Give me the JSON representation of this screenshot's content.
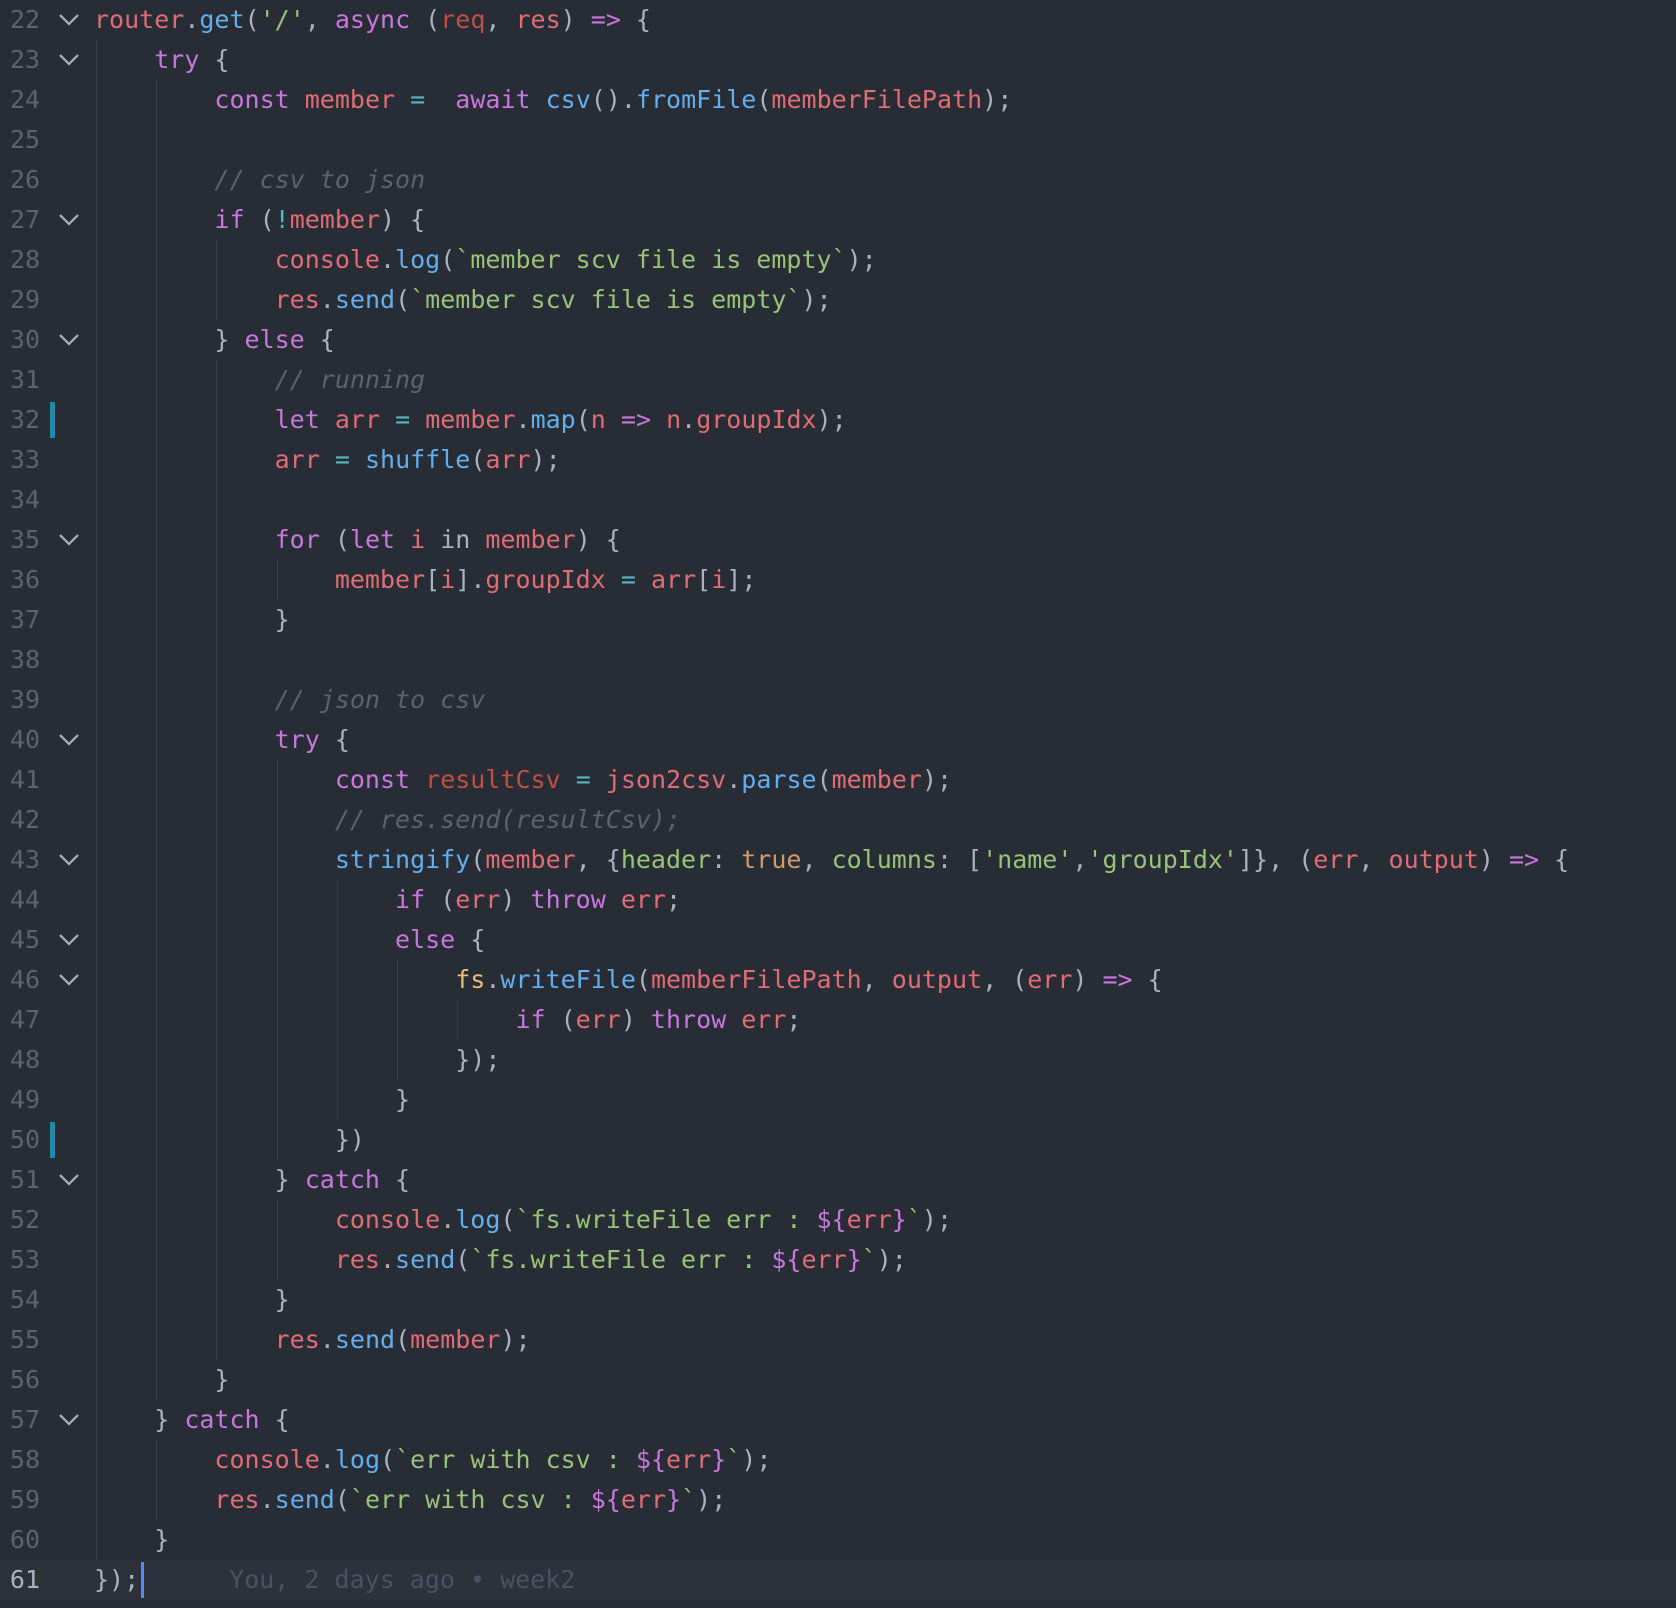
{
  "colors": {
    "background": "#282c34",
    "keyword": "#c678dd",
    "variable": "#e06c75",
    "function": "#61afef",
    "string": "#98c379",
    "comment": "#5c6370",
    "operator": "#56b6c2",
    "number": "#d19a66",
    "class": "#e5c07b",
    "punctuation": "#abb2bf",
    "git_modified": "#1f8ba5",
    "cursor": "#528bff"
  },
  "editor": {
    "current_line": 61,
    "blame": "You, 2 days ago • week2",
    "lines": [
      {
        "n": "22",
        "fold": true,
        "tokens": [
          [
            "v",
            "router"
          ],
          [
            "p",
            "."
          ],
          [
            "f",
            "get"
          ],
          [
            "p",
            "("
          ],
          [
            "s",
            "'/'"
          ],
          [
            "p",
            ", "
          ],
          [
            "k",
            "async"
          ],
          [
            "p",
            " ("
          ],
          [
            "pv",
            "req"
          ],
          [
            "p",
            ", "
          ],
          [
            "v",
            "res"
          ],
          [
            "p",
            ") "
          ],
          [
            "k",
            "=>"
          ],
          [
            "p",
            " {"
          ]
        ]
      },
      {
        "n": "23",
        "fold": true,
        "tokens": [
          [
            "p",
            "    "
          ],
          [
            "k",
            "try"
          ],
          [
            "p",
            " {"
          ]
        ]
      },
      {
        "n": "24",
        "fold": false,
        "tokens": [
          [
            "p",
            "        "
          ],
          [
            "k",
            "const"
          ],
          [
            "p",
            " "
          ],
          [
            "v",
            "member"
          ],
          [
            "p",
            " "
          ],
          [
            "o",
            "="
          ],
          [
            "p",
            "  "
          ],
          [
            "k",
            "await"
          ],
          [
            "p",
            " "
          ],
          [
            "f",
            "csv"
          ],
          [
            "p",
            "()."
          ],
          [
            "f",
            "fromFile"
          ],
          [
            "p",
            "("
          ],
          [
            "v",
            "memberFilePath"
          ],
          [
            "p",
            ");"
          ]
        ]
      },
      {
        "n": "25",
        "fold": false,
        "tokens": []
      },
      {
        "n": "26",
        "fold": false,
        "tokens": [
          [
            "p",
            "        "
          ],
          [
            "c",
            "// csv to json"
          ]
        ]
      },
      {
        "n": "27",
        "fold": true,
        "tokens": [
          [
            "p",
            "        "
          ],
          [
            "k",
            "if"
          ],
          [
            "p",
            " ("
          ],
          [
            "o",
            "!"
          ],
          [
            "v",
            "member"
          ],
          [
            "p",
            ") {"
          ]
        ]
      },
      {
        "n": "28",
        "fold": false,
        "tokens": [
          [
            "p",
            "            "
          ],
          [
            "v",
            "console"
          ],
          [
            "p",
            "."
          ],
          [
            "f",
            "log"
          ],
          [
            "p",
            "("
          ],
          [
            "s",
            "`member scv file is empty`"
          ],
          [
            "p",
            ");"
          ]
        ]
      },
      {
        "n": "29",
        "fold": false,
        "tokens": [
          [
            "p",
            "            "
          ],
          [
            "v",
            "res"
          ],
          [
            "p",
            "."
          ],
          [
            "f",
            "send"
          ],
          [
            "p",
            "("
          ],
          [
            "s",
            "`member scv file is empty`"
          ],
          [
            "p",
            ");"
          ]
        ]
      },
      {
        "n": "30",
        "fold": true,
        "tokens": [
          [
            "p",
            "        } "
          ],
          [
            "k",
            "else"
          ],
          [
            "p",
            " {"
          ]
        ]
      },
      {
        "n": "31",
        "fold": false,
        "tokens": [
          [
            "p",
            "            "
          ],
          [
            "c",
            "// running"
          ]
        ]
      },
      {
        "n": "32",
        "fold": false,
        "git": true,
        "tokens": [
          [
            "p",
            "            "
          ],
          [
            "k",
            "let"
          ],
          [
            "p",
            " "
          ],
          [
            "v",
            "arr"
          ],
          [
            "p",
            " "
          ],
          [
            "o",
            "="
          ],
          [
            "p",
            " "
          ],
          [
            "v",
            "member"
          ],
          [
            "p",
            "."
          ],
          [
            "f",
            "map"
          ],
          [
            "p",
            "("
          ],
          [
            "v",
            "n"
          ],
          [
            "p",
            " "
          ],
          [
            "k",
            "=>"
          ],
          [
            "p",
            " "
          ],
          [
            "v",
            "n"
          ],
          [
            "p",
            "."
          ],
          [
            "v",
            "groupIdx"
          ],
          [
            "p",
            ");"
          ]
        ]
      },
      {
        "n": "33",
        "fold": false,
        "tokens": [
          [
            "p",
            "            "
          ],
          [
            "v",
            "arr"
          ],
          [
            "p",
            " "
          ],
          [
            "o",
            "="
          ],
          [
            "p",
            " "
          ],
          [
            "f",
            "shuffle"
          ],
          [
            "p",
            "("
          ],
          [
            "v",
            "arr"
          ],
          [
            "p",
            ");"
          ]
        ]
      },
      {
        "n": "34",
        "fold": false,
        "tokens": []
      },
      {
        "n": "35",
        "fold": true,
        "tokens": [
          [
            "p",
            "            "
          ],
          [
            "k",
            "for"
          ],
          [
            "p",
            " ("
          ],
          [
            "k",
            "let"
          ],
          [
            "p",
            " "
          ],
          [
            "v",
            "i"
          ],
          [
            "p",
            " in "
          ],
          [
            "v",
            "member"
          ],
          [
            "p",
            ") {"
          ]
        ]
      },
      {
        "n": "36",
        "fold": false,
        "tokens": [
          [
            "p",
            "                "
          ],
          [
            "v",
            "member"
          ],
          [
            "p",
            "["
          ],
          [
            "v",
            "i"
          ],
          [
            "p",
            "]."
          ],
          [
            "v",
            "groupIdx"
          ],
          [
            "p",
            " "
          ],
          [
            "o",
            "="
          ],
          [
            "p",
            " "
          ],
          [
            "v",
            "arr"
          ],
          [
            "p",
            "["
          ],
          [
            "v",
            "i"
          ],
          [
            "p",
            "];"
          ]
        ]
      },
      {
        "n": "37",
        "fold": false,
        "tokens": [
          [
            "p",
            "            }"
          ]
        ]
      },
      {
        "n": "38",
        "fold": false,
        "tokens": []
      },
      {
        "n": "39",
        "fold": false,
        "tokens": [
          [
            "p",
            "            "
          ],
          [
            "c",
            "// json to csv"
          ]
        ]
      },
      {
        "n": "40",
        "fold": true,
        "tokens": [
          [
            "p",
            "            "
          ],
          [
            "k",
            "try"
          ],
          [
            "p",
            " {"
          ]
        ]
      },
      {
        "n": "41",
        "fold": false,
        "tokens": [
          [
            "p",
            "                "
          ],
          [
            "k",
            "const"
          ],
          [
            "p",
            " "
          ],
          [
            "pv",
            "resultCsv"
          ],
          [
            "p",
            " "
          ],
          [
            "o",
            "="
          ],
          [
            "p",
            " "
          ],
          [
            "v",
            "json2csv"
          ],
          [
            "p",
            "."
          ],
          [
            "f",
            "parse"
          ],
          [
            "p",
            "("
          ],
          [
            "v",
            "member"
          ],
          [
            "p",
            ");"
          ]
        ]
      },
      {
        "n": "42",
        "fold": false,
        "tokens": [
          [
            "p",
            "                "
          ],
          [
            "c",
            "// res.send(resultCsv);"
          ]
        ]
      },
      {
        "n": "43",
        "fold": true,
        "tokens": [
          [
            "p",
            "                "
          ],
          [
            "f",
            "stringify"
          ],
          [
            "p",
            "("
          ],
          [
            "v",
            "member"
          ],
          [
            "p",
            ", {"
          ],
          [
            "s",
            "header"
          ],
          [
            "p",
            ": "
          ],
          [
            "n",
            "true"
          ],
          [
            "p",
            ", "
          ],
          [
            "s",
            "columns"
          ],
          [
            "p",
            ": ["
          ],
          [
            "s",
            "'name'"
          ],
          [
            "p",
            ","
          ],
          [
            "s",
            "'groupIdx'"
          ],
          [
            "p",
            "]}, ("
          ],
          [
            "v",
            "err"
          ],
          [
            "p",
            ", "
          ],
          [
            "v",
            "output"
          ],
          [
            "p",
            ") "
          ],
          [
            "k",
            "=>"
          ],
          [
            "p",
            " {"
          ]
        ]
      },
      {
        "n": "44",
        "fold": false,
        "tokens": [
          [
            "p",
            "                    "
          ],
          [
            "k",
            "if"
          ],
          [
            "p",
            " ("
          ],
          [
            "v",
            "err"
          ],
          [
            "p",
            ") "
          ],
          [
            "k",
            "throw"
          ],
          [
            "p",
            " "
          ],
          [
            "v",
            "err"
          ],
          [
            "p",
            ";"
          ]
        ]
      },
      {
        "n": "45",
        "fold": true,
        "tokens": [
          [
            "p",
            "                    "
          ],
          [
            "k",
            "else"
          ],
          [
            "p",
            " {"
          ]
        ]
      },
      {
        "n": "46",
        "fold": true,
        "tokens": [
          [
            "p",
            "                        "
          ],
          [
            "y",
            "fs"
          ],
          [
            "p",
            "."
          ],
          [
            "f",
            "writeFile"
          ],
          [
            "p",
            "("
          ],
          [
            "v",
            "memberFilePath"
          ],
          [
            "p",
            ", "
          ],
          [
            "v",
            "output"
          ],
          [
            "p",
            ", ("
          ],
          [
            "v",
            "err"
          ],
          [
            "p",
            ") "
          ],
          [
            "k",
            "=>"
          ],
          [
            "p",
            " {"
          ]
        ]
      },
      {
        "n": "47",
        "fold": false,
        "tokens": [
          [
            "p",
            "                            "
          ],
          [
            "k",
            "if"
          ],
          [
            "p",
            " ("
          ],
          [
            "v",
            "err"
          ],
          [
            "p",
            ") "
          ],
          [
            "k",
            "throw"
          ],
          [
            "p",
            " "
          ],
          [
            "v",
            "err"
          ],
          [
            "p",
            ";"
          ]
        ]
      },
      {
        "n": "48",
        "fold": false,
        "tokens": [
          [
            "p",
            "                        });"
          ]
        ]
      },
      {
        "n": "49",
        "fold": false,
        "tokens": [
          [
            "p",
            "                    }"
          ]
        ]
      },
      {
        "n": "50",
        "fold": false,
        "git": true,
        "tokens": [
          [
            "p",
            "                })"
          ]
        ]
      },
      {
        "n": "51",
        "fold": true,
        "tokens": [
          [
            "p",
            "            } "
          ],
          [
            "k",
            "catch"
          ],
          [
            "p",
            " {"
          ]
        ]
      },
      {
        "n": "52",
        "fold": false,
        "tokens": [
          [
            "p",
            "                "
          ],
          [
            "v",
            "console"
          ],
          [
            "p",
            "."
          ],
          [
            "f",
            "log"
          ],
          [
            "p",
            "("
          ],
          [
            "s",
            "`fs.writeFile err : "
          ],
          [
            "k",
            "${"
          ],
          [
            "v",
            "err"
          ],
          [
            "k",
            "}"
          ],
          [
            "s",
            "`"
          ],
          [
            "p",
            ");"
          ]
        ]
      },
      {
        "n": "53",
        "fold": false,
        "tokens": [
          [
            "p",
            "                "
          ],
          [
            "v",
            "res"
          ],
          [
            "p",
            "."
          ],
          [
            "f",
            "send"
          ],
          [
            "p",
            "("
          ],
          [
            "s",
            "`fs.writeFile err : "
          ],
          [
            "k",
            "${"
          ],
          [
            "v",
            "err"
          ],
          [
            "k",
            "}"
          ],
          [
            "s",
            "`"
          ],
          [
            "p",
            ");"
          ]
        ]
      },
      {
        "n": "54",
        "fold": false,
        "tokens": [
          [
            "p",
            "            }"
          ]
        ]
      },
      {
        "n": "55",
        "fold": false,
        "tokens": [
          [
            "p",
            "            "
          ],
          [
            "v",
            "res"
          ],
          [
            "p",
            "."
          ],
          [
            "f",
            "send"
          ],
          [
            "p",
            "("
          ],
          [
            "v",
            "member"
          ],
          [
            "p",
            ");"
          ]
        ]
      },
      {
        "n": "56",
        "fold": false,
        "tokens": [
          [
            "p",
            "        }"
          ]
        ]
      },
      {
        "n": "57",
        "fold": true,
        "tokens": [
          [
            "p",
            "    } "
          ],
          [
            "k",
            "catch"
          ],
          [
            "p",
            " {"
          ]
        ]
      },
      {
        "n": "58",
        "fold": false,
        "tokens": [
          [
            "p",
            "        "
          ],
          [
            "v",
            "console"
          ],
          [
            "p",
            "."
          ],
          [
            "f",
            "log"
          ],
          [
            "p",
            "("
          ],
          [
            "s",
            "`err with csv : "
          ],
          [
            "k",
            "${"
          ],
          [
            "v",
            "err"
          ],
          [
            "k",
            "}"
          ],
          [
            "s",
            "`"
          ],
          [
            "p",
            ");"
          ]
        ]
      },
      {
        "n": "59",
        "fold": false,
        "tokens": [
          [
            "p",
            "        "
          ],
          [
            "v",
            "res"
          ],
          [
            "p",
            "."
          ],
          [
            "f",
            "send"
          ],
          [
            "p",
            "("
          ],
          [
            "s",
            "`err with csv : "
          ],
          [
            "k",
            "${"
          ],
          [
            "v",
            "err"
          ],
          [
            "k",
            "}"
          ],
          [
            "s",
            "`"
          ],
          [
            "p",
            ");"
          ]
        ]
      },
      {
        "n": "60",
        "fold": false,
        "tokens": [
          [
            "p",
            "    }"
          ]
        ]
      },
      {
        "n": "61",
        "fold": false,
        "tokens": [
          [
            "p",
            "});"
          ]
        ]
      }
    ]
  }
}
